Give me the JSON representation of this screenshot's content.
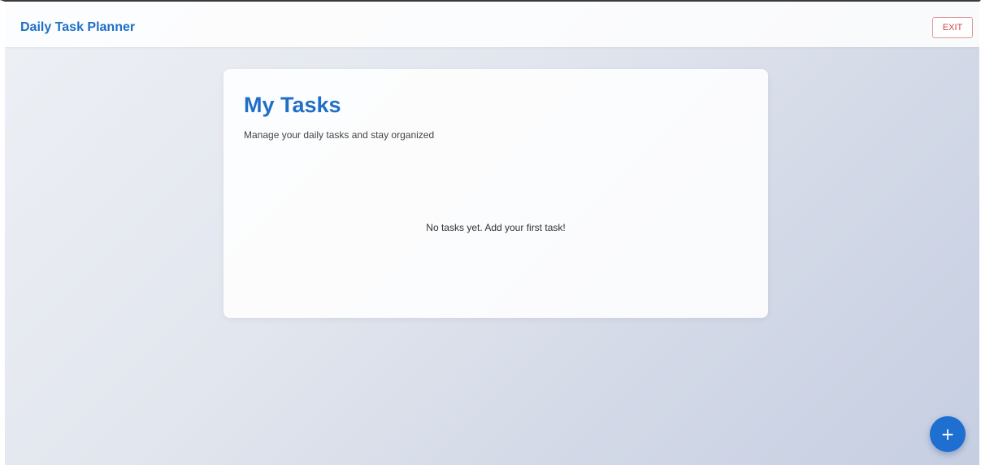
{
  "header": {
    "title": "Daily Task Planner",
    "exit_label": "EXIT"
  },
  "tasks_card": {
    "title": "My Tasks",
    "subtitle": "Manage your daily tasks and stay organized",
    "empty_message": "No tasks yet. Add your first task!"
  },
  "fab": {
    "icon": "plus-icon",
    "symbol": "+"
  },
  "colors": {
    "accent": "#1f6fc9",
    "exit_text": "#d04a4a",
    "exit_border": "#e19a9a",
    "fab": "#1e6fd0"
  }
}
